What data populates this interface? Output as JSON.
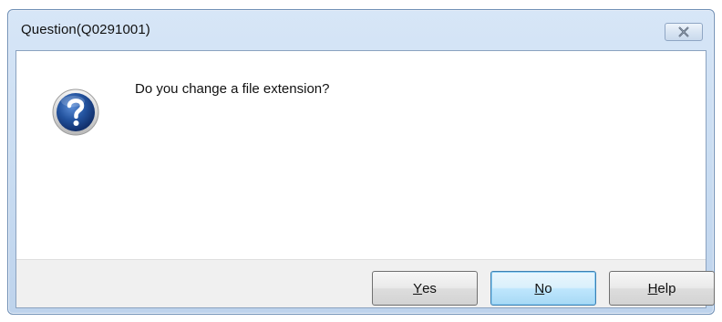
{
  "dialog": {
    "title": "Question(Q0291001)",
    "message": "Do you change a file extension?",
    "icon": "question-icon"
  },
  "buttons": {
    "yes": {
      "mnemonic": "Y",
      "rest": "es"
    },
    "no": {
      "mnemonic": "N",
      "rest": "o"
    },
    "help": {
      "mnemonic": "H",
      "rest": "elp"
    }
  },
  "colors": {
    "icon_blue": "#1f4f9c",
    "title_bar": "#c7dbf1",
    "default_button_border": "#3c7fb1"
  }
}
